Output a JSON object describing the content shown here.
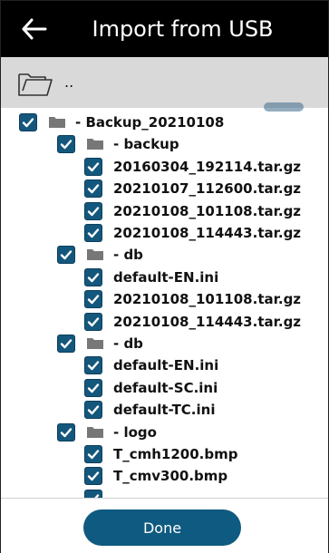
{
  "header": {
    "title": "Import from USB",
    "back_icon": "back-arrow-icon"
  },
  "pathbar": {
    "folder_icon": "folder-outline-icon",
    "path": ".."
  },
  "tree": {
    "items": [
      {
        "kind": "folder",
        "level": 0,
        "label": "- Backup_20210108",
        "checked": true
      },
      {
        "kind": "folder",
        "level": 1,
        "label": "- backup",
        "checked": true
      },
      {
        "kind": "file",
        "level": 2,
        "label": "20160304_192114.tar.gz",
        "checked": true
      },
      {
        "kind": "file",
        "level": 2,
        "label": "20210107_112600.tar.gz",
        "checked": true
      },
      {
        "kind": "file",
        "level": 2,
        "label": "20210108_101108.tar.gz",
        "checked": true
      },
      {
        "kind": "file",
        "level": 2,
        "label": "20210108_114443.tar.gz",
        "checked": true
      },
      {
        "kind": "folder",
        "level": 1,
        "label": "- db",
        "checked": true
      },
      {
        "kind": "file",
        "level": 2,
        "label": "default-EN.ini",
        "checked": true
      },
      {
        "kind": "file",
        "level": 2,
        "label": "20210108_101108.tar.gz",
        "checked": true
      },
      {
        "kind": "file",
        "level": 2,
        "label": "20210108_114443.tar.gz",
        "checked": true
      },
      {
        "kind": "folder",
        "level": 1,
        "label": "- db",
        "checked": true
      },
      {
        "kind": "file",
        "level": 2,
        "label": "default-EN.ini",
        "checked": true
      },
      {
        "kind": "file",
        "level": 2,
        "label": "default-SC.ini",
        "checked": true
      },
      {
        "kind": "file",
        "level": 2,
        "label": "default-TC.ini",
        "checked": true
      },
      {
        "kind": "folder",
        "level": 1,
        "label": "- logo",
        "checked": true
      },
      {
        "kind": "file",
        "level": 2,
        "label": "T_cmh1200.bmp",
        "checked": true
      },
      {
        "kind": "file",
        "level": 2,
        "label": "T_cmv300.bmp",
        "checked": true
      },
      {
        "kind": "file",
        "level": 2,
        "label": "",
        "checked": true
      }
    ]
  },
  "footer": {
    "done_label": "Done"
  },
  "colors": {
    "accent": "#0f5a80",
    "checkbox": "#14577d",
    "titlebar": "#000000",
    "pathbar": "#d9d9d9"
  }
}
